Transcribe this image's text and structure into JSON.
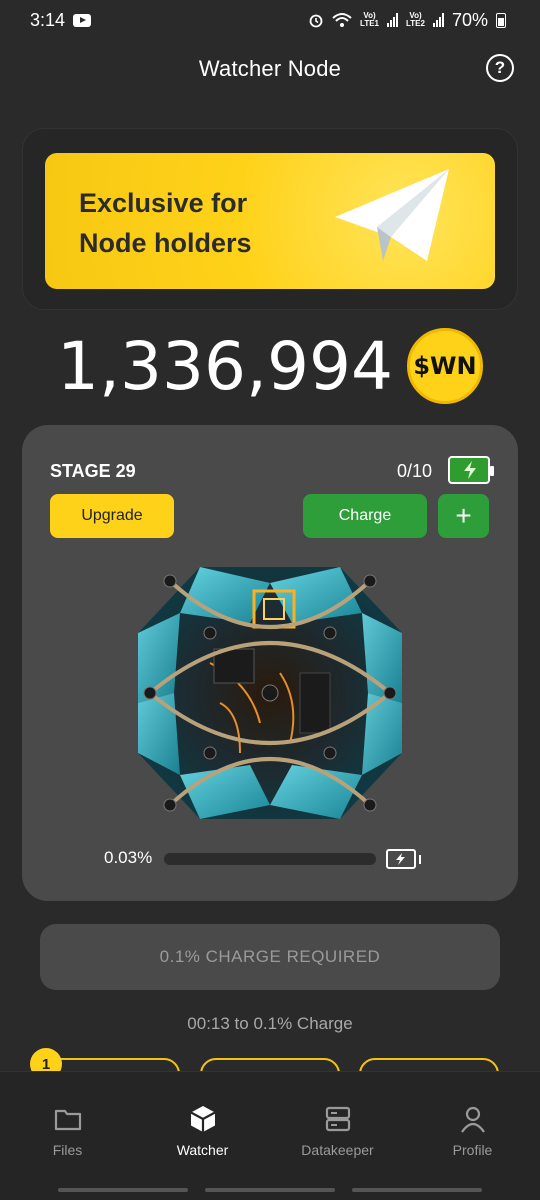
{
  "status_bar": {
    "time": "3:14",
    "battery": "70%",
    "sim1": "LTE1",
    "sim2": "LTE2"
  },
  "header": {
    "title": "Watcher Node",
    "help_icon": "question-circle-icon"
  },
  "promo": {
    "line1": "Exclusive for",
    "line2": "Node holders",
    "icon": "telegram-plane-icon",
    "bg_color": "#ffd21a"
  },
  "balance": {
    "value": "1,336,994",
    "token": "$WN"
  },
  "stage": {
    "label": "STAGE 29",
    "count": "0/10",
    "upgrade_label": "Upgrade",
    "charge_label": "Charge",
    "plus_label": "+",
    "progress_text": "0.03%",
    "progress_value": 0.03
  },
  "charge_required": {
    "label": "0.1% CHARGE REQUIRED"
  },
  "timer": {
    "text": "00:13  to 0.1% Charge"
  },
  "tiers": {
    "badge": "1"
  },
  "nav": {
    "items": [
      {
        "label": "Files",
        "icon": "folder-icon"
      },
      {
        "label": "Watcher",
        "icon": "cube-icon"
      },
      {
        "label": "Datakeeper",
        "icon": "server-icon"
      },
      {
        "label": "Profile",
        "icon": "user-icon"
      }
    ],
    "active": "Watcher"
  },
  "colors": {
    "accent_yellow": "#ffd21a",
    "accent_green": "#2e9e3a",
    "background": "#2a2a2a",
    "card": "#4a4a4a"
  }
}
